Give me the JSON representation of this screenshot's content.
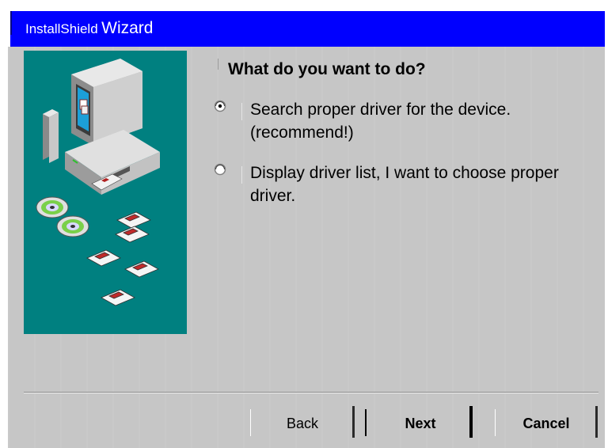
{
  "window": {
    "title_small": "InstallShield",
    "title_large": "Wizard"
  },
  "heading": "What do you want to do?",
  "options": [
    {
      "label": "Search proper driver for the device. (recommend!)",
      "selected": true
    },
    {
      "label": "Display driver list, I want to choose proper driver.",
      "selected": false
    }
  ],
  "buttons": {
    "back": "Back",
    "next": "Next",
    "cancel": "Cancel"
  },
  "colors": {
    "titlebar": "#0000ff",
    "dialog_bg": "#c6c6c6",
    "illustration_bg": "#008080"
  },
  "icons": {
    "illustration": "computer-cds-floppies-illustration",
    "radio_selected": "radio-checked-icon",
    "radio_unselected": "radio-unchecked-icon"
  }
}
